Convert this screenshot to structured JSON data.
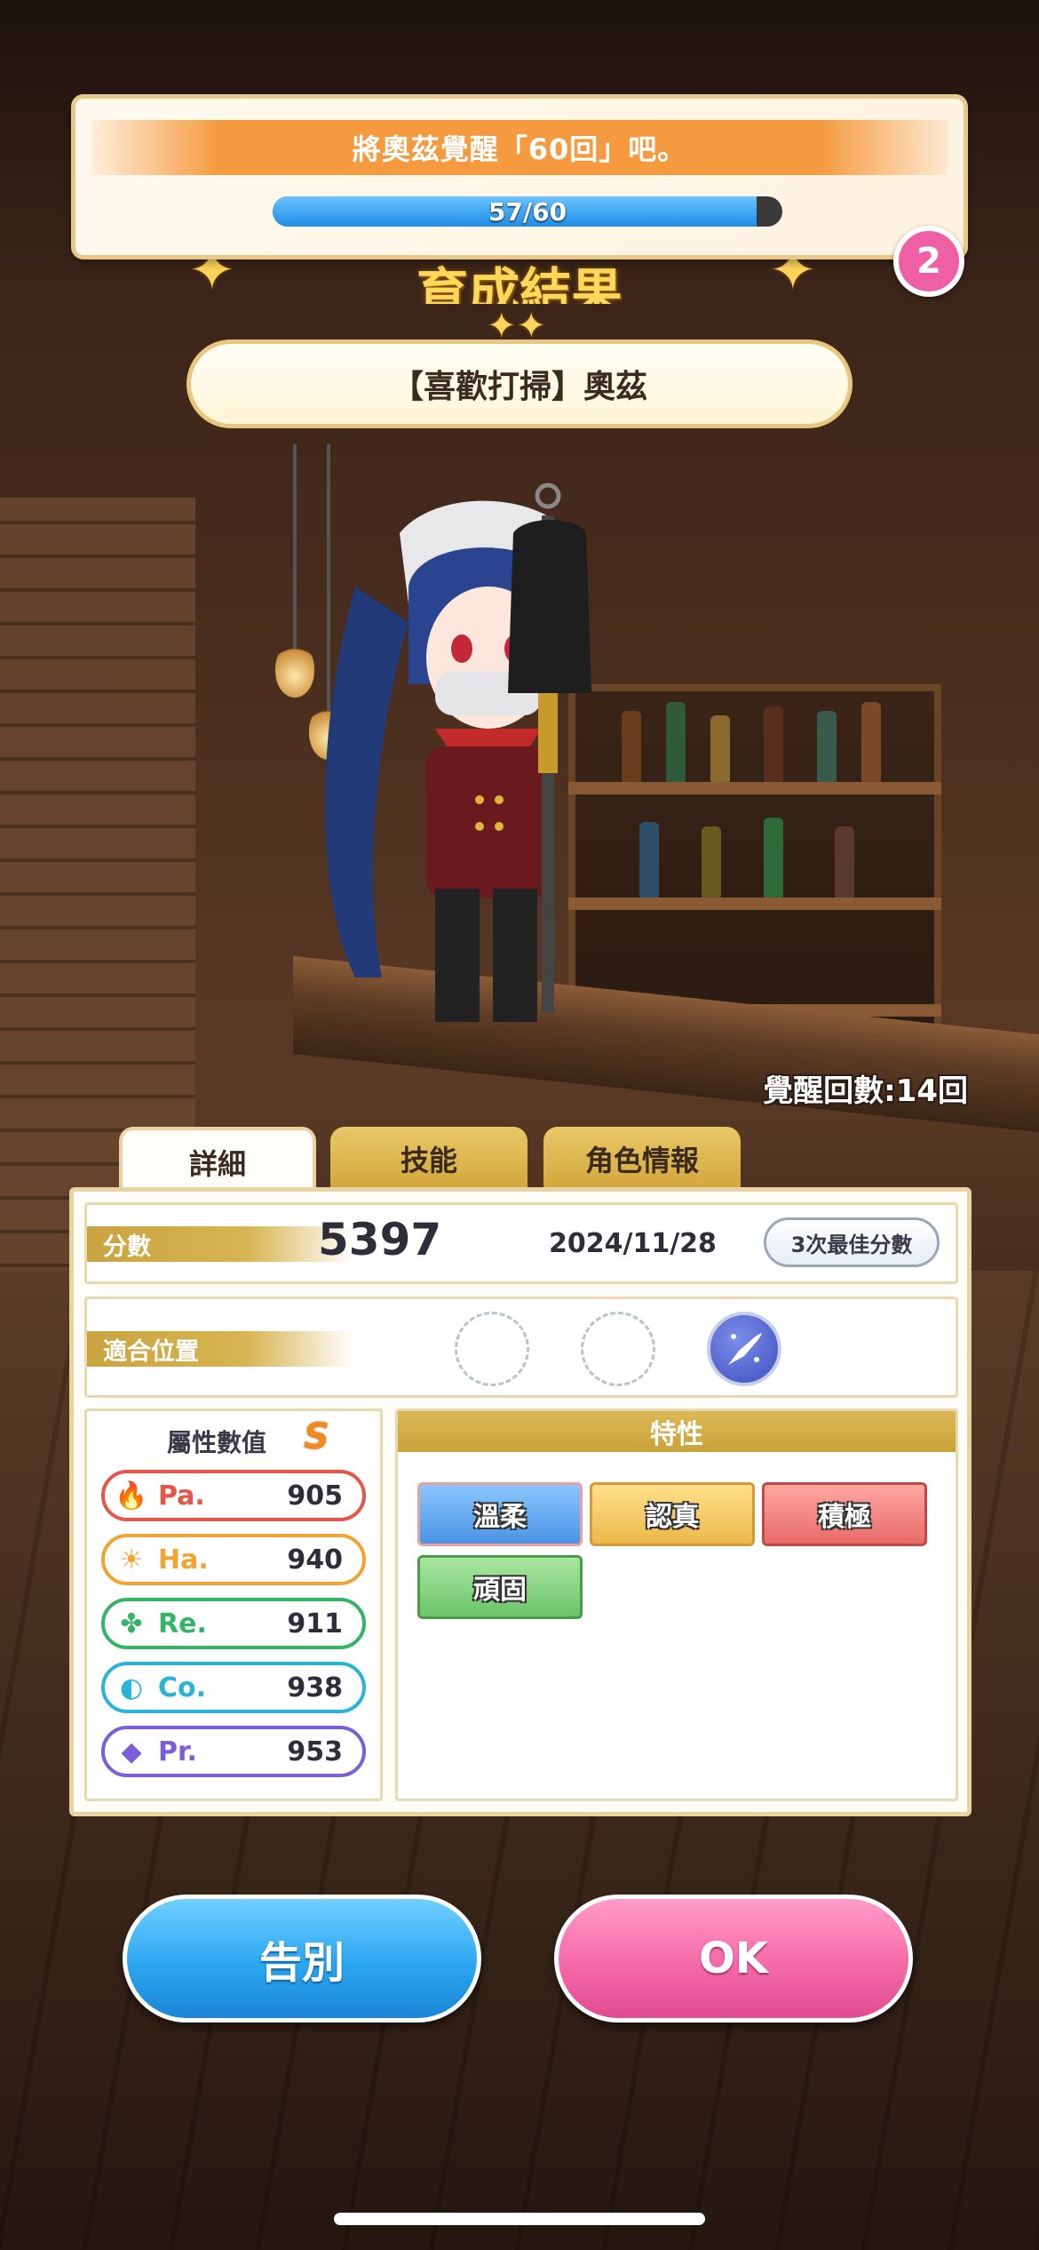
{
  "mission": {
    "text": "將奧茲覺醒「60回」吧。",
    "progress_text": "57/60",
    "progress_fraction": 0.95,
    "badge_count": "2"
  },
  "result_title": "育成結果",
  "character": {
    "name": "【喜歡打掃】奧茲"
  },
  "awaken_count": "覺醒回數:14回",
  "tabs": [
    "詳細",
    "技能",
    "角色情報"
  ],
  "score": {
    "label": "分數",
    "value": "5397",
    "date": "2024/11/28",
    "best_button": "3次最佳分數"
  },
  "position": {
    "label": "適合位置",
    "active_index": 2
  },
  "attributes": {
    "title": "屬性數值",
    "rank": "S",
    "items": [
      {
        "name": "Pa.",
        "value": "905",
        "color": "#e6554a",
        "icon": "fire-icon"
      },
      {
        "name": "Ha.",
        "value": "940",
        "color": "#f2a433",
        "icon": "sun-icon"
      },
      {
        "name": "Re.",
        "value": "911",
        "color": "#33b565",
        "icon": "clover-icon"
      },
      {
        "name": "Co.",
        "value": "938",
        "color": "#28b4d6",
        "icon": "planet-icon"
      },
      {
        "name": "Pr.",
        "value": "953",
        "color": "#7b5fd9",
        "icon": "diamond-icon"
      }
    ]
  },
  "traits": {
    "title": "特性",
    "items": [
      {
        "label": "溫柔",
        "color": "#5aa6f0"
      },
      {
        "label": "認真",
        "color": "#f0c25a"
      },
      {
        "label": "積極",
        "color": "#ec7676"
      },
      {
        "label": "頑固",
        "color": "#7ccf7a"
      }
    ]
  },
  "buttons": {
    "farewell": "告別",
    "ok": "OK"
  }
}
